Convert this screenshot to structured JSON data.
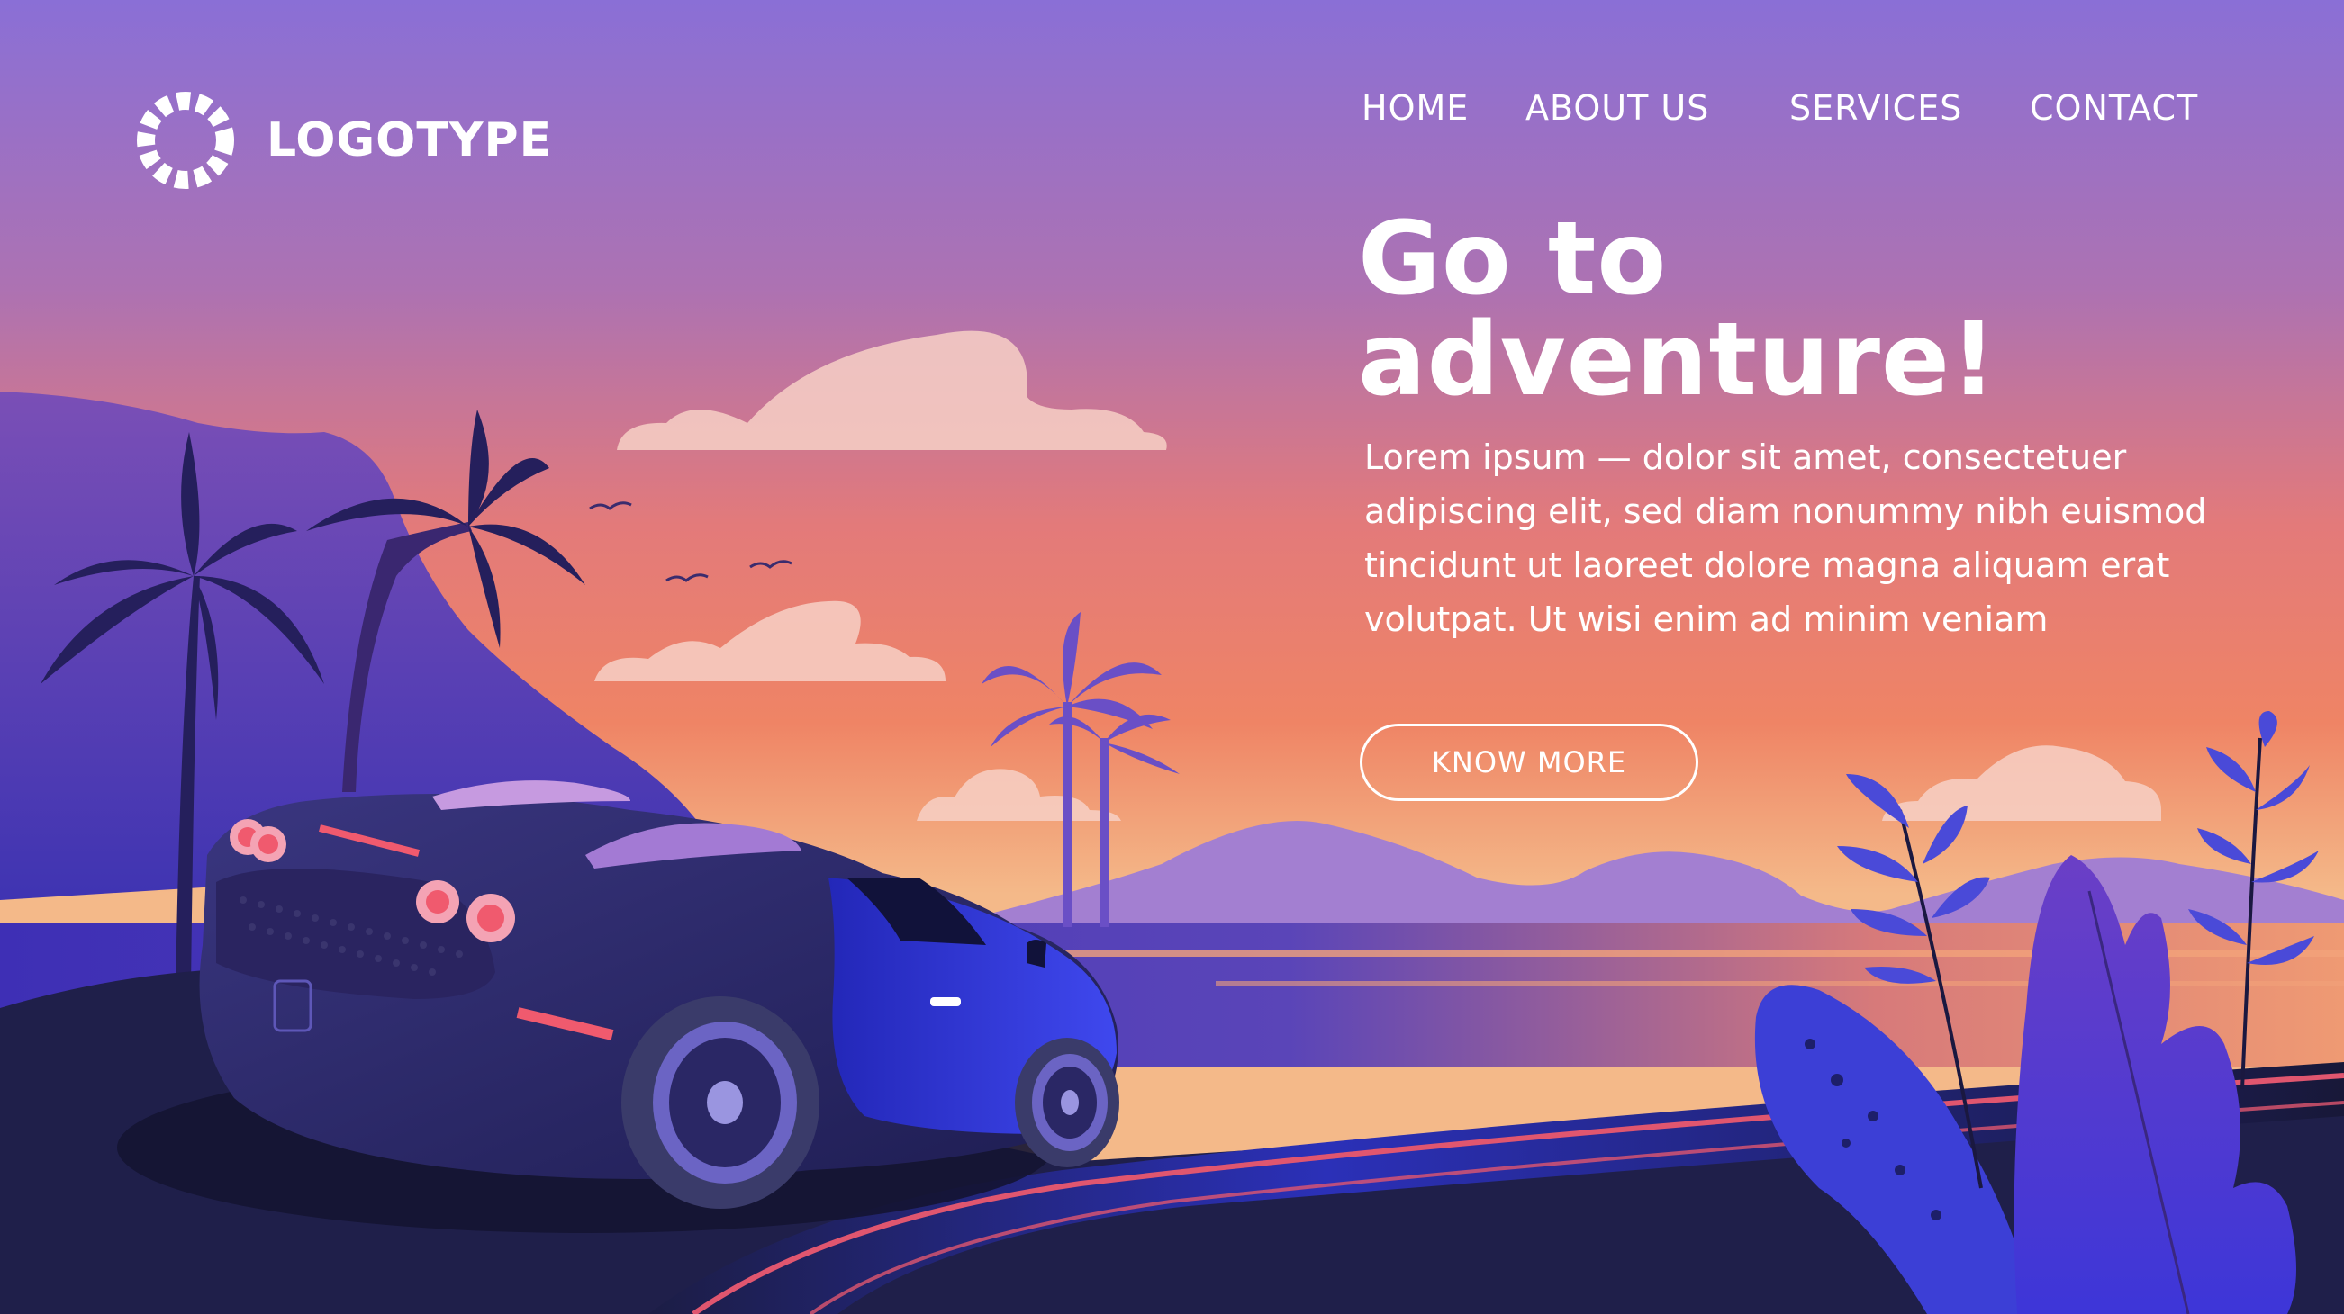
{
  "logo": {
    "text": "LOGOTYPE"
  },
  "nav": {
    "items": [
      {
        "label": "HOME"
      },
      {
        "label": "ABOUT US"
      },
      {
        "label": "SERVICES"
      },
      {
        "label": "CONTACT"
      }
    ]
  },
  "hero": {
    "title_line1": "Go to",
    "title_line2": "adventure!",
    "body_lines": [
      "Lorem ipsum — dolor sit amet, consectetuer",
      "adipiscing elit, sed diam nonummy nibh euismod",
      "tincidunt ut laoreet dolore magna aliquam erat",
      "volutpat. Ut wisi enim ad minim veniam"
    ],
    "button_label": "KNOW MORE"
  },
  "colors": {
    "sky_top": "#8a6fd6",
    "sky_mid": "#ee7c63",
    "sky_low": "#f4b989",
    "mountain_far": "#a47ed2",
    "hill_near": "#5a3fb0",
    "road": "#1e1f4a",
    "car_body": "#2c2a68",
    "car_front": "#2a2fd0",
    "foliage": "#3c3fd6",
    "text": "#ffffff"
  },
  "icons": {
    "logo": "dashed-ring-logo-icon"
  }
}
